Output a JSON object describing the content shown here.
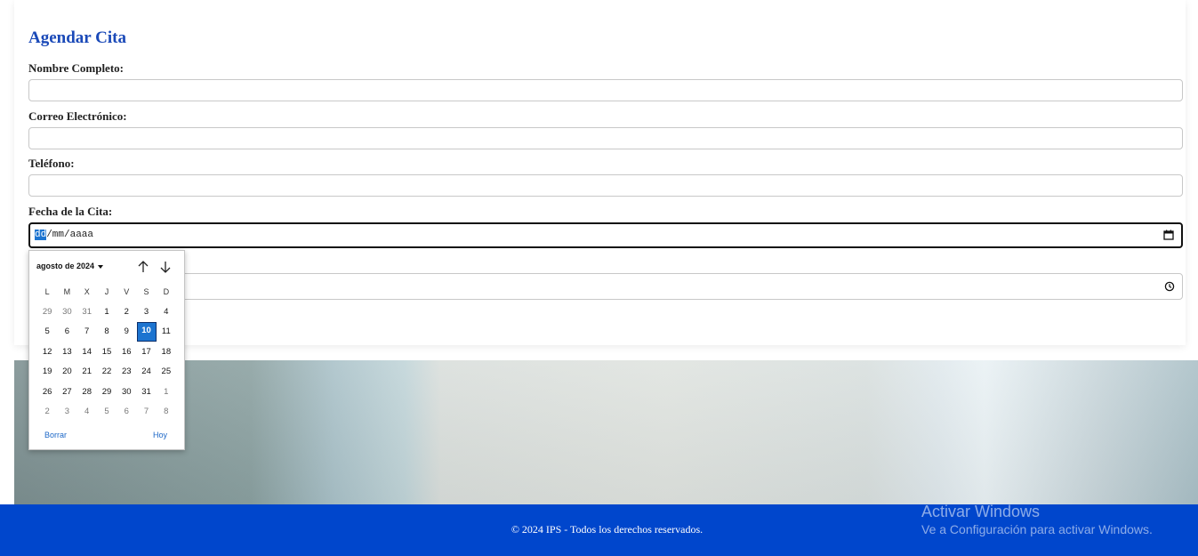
{
  "form": {
    "title": "Agendar Cita",
    "fields": {
      "name_label": "Nombre Completo:",
      "email_label": "Correo Electrónico:",
      "phone_label": "Teléfono:",
      "date_label": "Fecha de la Cita:"
    },
    "date_input": {
      "day_placeholder": "dd",
      "rest_placeholder": "/mm/aaaa"
    }
  },
  "datepicker": {
    "month_label": "agosto de 2024",
    "weekday_headers": [
      "L",
      "M",
      "X",
      "J",
      "V",
      "S",
      "D"
    ],
    "weeks": [
      [
        "29",
        "30",
        "31",
        "1",
        "2",
        "3",
        "4"
      ],
      [
        "5",
        "6",
        "7",
        "8",
        "9",
        "10",
        "11"
      ],
      [
        "12",
        "13",
        "14",
        "15",
        "16",
        "17",
        "18"
      ],
      [
        "19",
        "20",
        "21",
        "22",
        "23",
        "24",
        "25"
      ],
      [
        "26",
        "27",
        "28",
        "29",
        "30",
        "31",
        "1"
      ],
      [
        "2",
        "3",
        "4",
        "5",
        "6",
        "7",
        "8"
      ]
    ],
    "selected_day": "10",
    "clear_label": "Borrar",
    "today_label": "Hoy"
  },
  "footer": {
    "text": "© 2024 IPS - Todos los derechos reservados."
  },
  "watermark": {
    "title": "Activar Windows",
    "subtitle": "Ve a Configuración para activar Windows."
  },
  "colors": {
    "title": "#1a49b8",
    "footer_bg": "#0046cc",
    "selected_day": "#1c74d0",
    "link": "#1c67c7"
  },
  "icons": {
    "calendar": "calendar-icon",
    "clock": "clock-icon",
    "prev_month": "arrow-up-icon",
    "next_month": "arrow-down-icon"
  }
}
